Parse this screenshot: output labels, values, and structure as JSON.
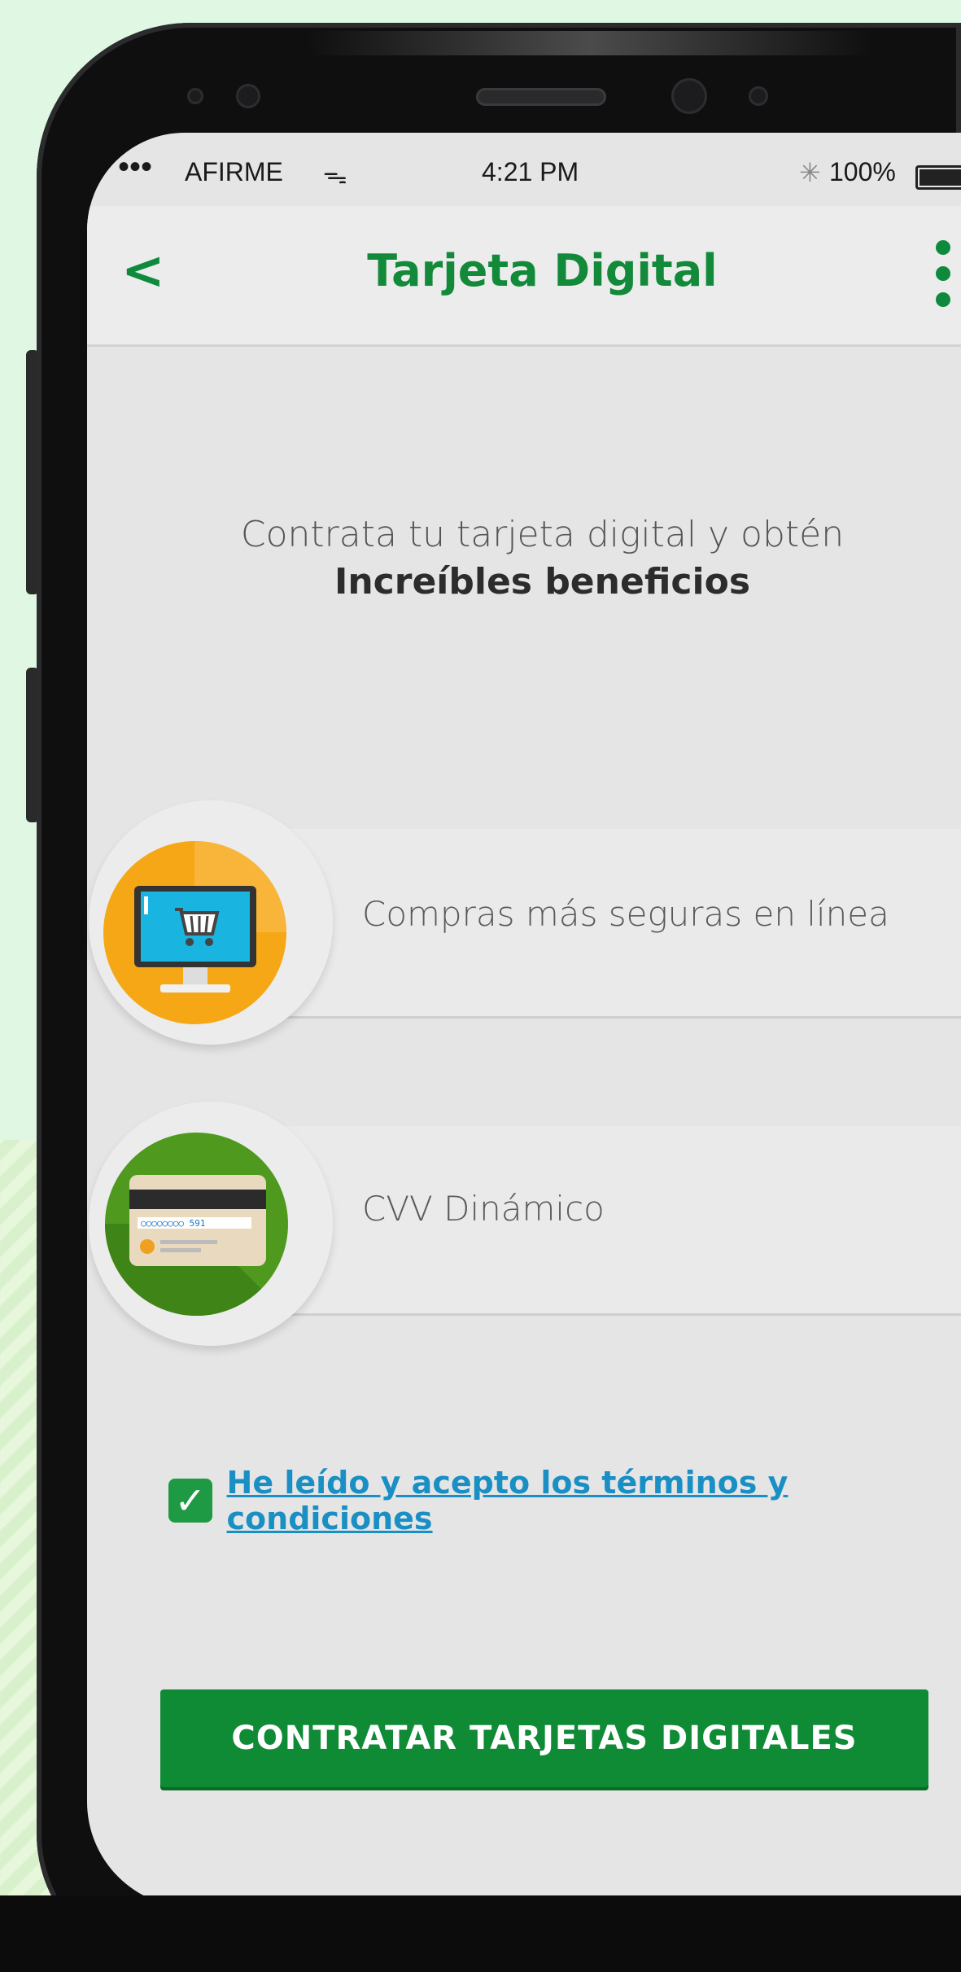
{
  "status_bar": {
    "signal": "•••",
    "carrier": "AFIRME",
    "wifi": "ᯓ",
    "time": "4:21 PM",
    "bluetooth": "✳",
    "battery": "100%"
  },
  "header": {
    "back_icon": "chevron-left-icon",
    "back_glyph": "<",
    "title": "Tarjeta Digital",
    "menu_icon": "kebab-menu-icon"
  },
  "intro": {
    "line1": "Contrata tu tarjeta digital y obtén",
    "line2": "Increíbles beneficios"
  },
  "benefits": [
    {
      "icon": "shopping-cart-monitor-icon",
      "label": "Compras más seguras en línea"
    },
    {
      "icon": "credit-card-cvv-icon",
      "label": "CVV Dinámico"
    }
  ],
  "terms": {
    "checked": true,
    "check_glyph": "✓",
    "label": "He leído y acepto los términos y condiciones"
  },
  "cta": {
    "label": "CONTRATAR TARJETAS DIGITALES"
  },
  "colors": {
    "brand_green": "#138a3a",
    "button_green": "#0f8a35",
    "link_blue": "#1a8fc4",
    "screen_bg": "#e5e5e6"
  }
}
